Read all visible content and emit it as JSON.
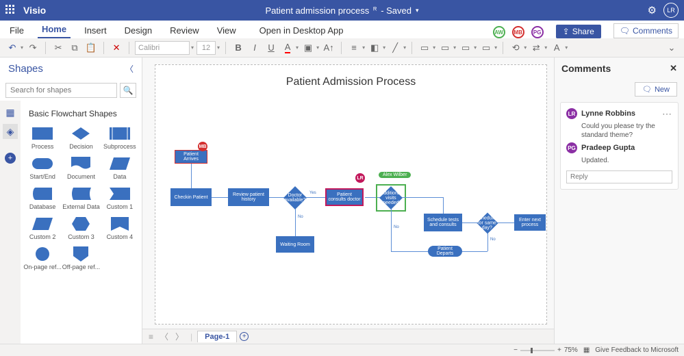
{
  "titlebar": {
    "appname": "Visio",
    "docname": "Patient admission process",
    "saved": "- Saved",
    "user_initials": "LR"
  },
  "menu": {
    "tabs": [
      "File",
      "Home",
      "Insert",
      "Design",
      "Review",
      "View"
    ],
    "open_desktop": "Open in Desktop App",
    "share": "Share",
    "comments": "Comments",
    "presence": [
      {
        "initials": "AW",
        "color": "#4caf50"
      },
      {
        "initials": "MB",
        "color": "#d32f2f"
      },
      {
        "initials": "PG",
        "color": "#8b2fa4"
      }
    ]
  },
  "ribbon": {
    "font": "Calibri",
    "size": "12"
  },
  "shapes": {
    "panel_title": "Shapes",
    "search_placeholder": "Search for shapes",
    "gallery_title": "Basic Flowchart Shapes",
    "items": [
      "Process",
      "Decision",
      "Subprocess",
      "Start/End",
      "Document",
      "Data",
      "Database",
      "External Data",
      "Custom 1",
      "Custom 2",
      "Custom 3",
      "Custom 4",
      "On-page ref...",
      "Off-page ref..."
    ]
  },
  "canvas": {
    "title": "Patient Admission Process",
    "nodes": {
      "n1": "Patient Arrives",
      "n2": "Checkin Patient",
      "n3": "Review patient history",
      "n4": "Doctor available?",
      "n5": "Patient consults doctor",
      "n6": "Additional visits needed",
      "n7": "Waiting Room",
      "n8": "Schedule tests and consults",
      "n9": "Scheduled for same day?",
      "n10": "Enter next process",
      "n11": "Patient Departs"
    },
    "labels": {
      "yes": "Yes",
      "no": "No"
    },
    "badges": {
      "mb": "MB",
      "lr": "LR",
      "aw": "Alex Wilber"
    }
  },
  "pagetabs": {
    "page": "Page-1"
  },
  "comments": {
    "title": "Comments",
    "new": "New",
    "c1_author": "Lynne Robbins",
    "c1_initials": "LR",
    "c1_text": "Could you please try the standard theme?",
    "c2_author": "Pradeep Gupta",
    "c2_initials": "PG",
    "c2_text": "Updated.",
    "reply_placeholder": "Reply"
  },
  "statusbar": {
    "zoom": "75%",
    "feedback": "Give Feedback to Microsoft"
  }
}
